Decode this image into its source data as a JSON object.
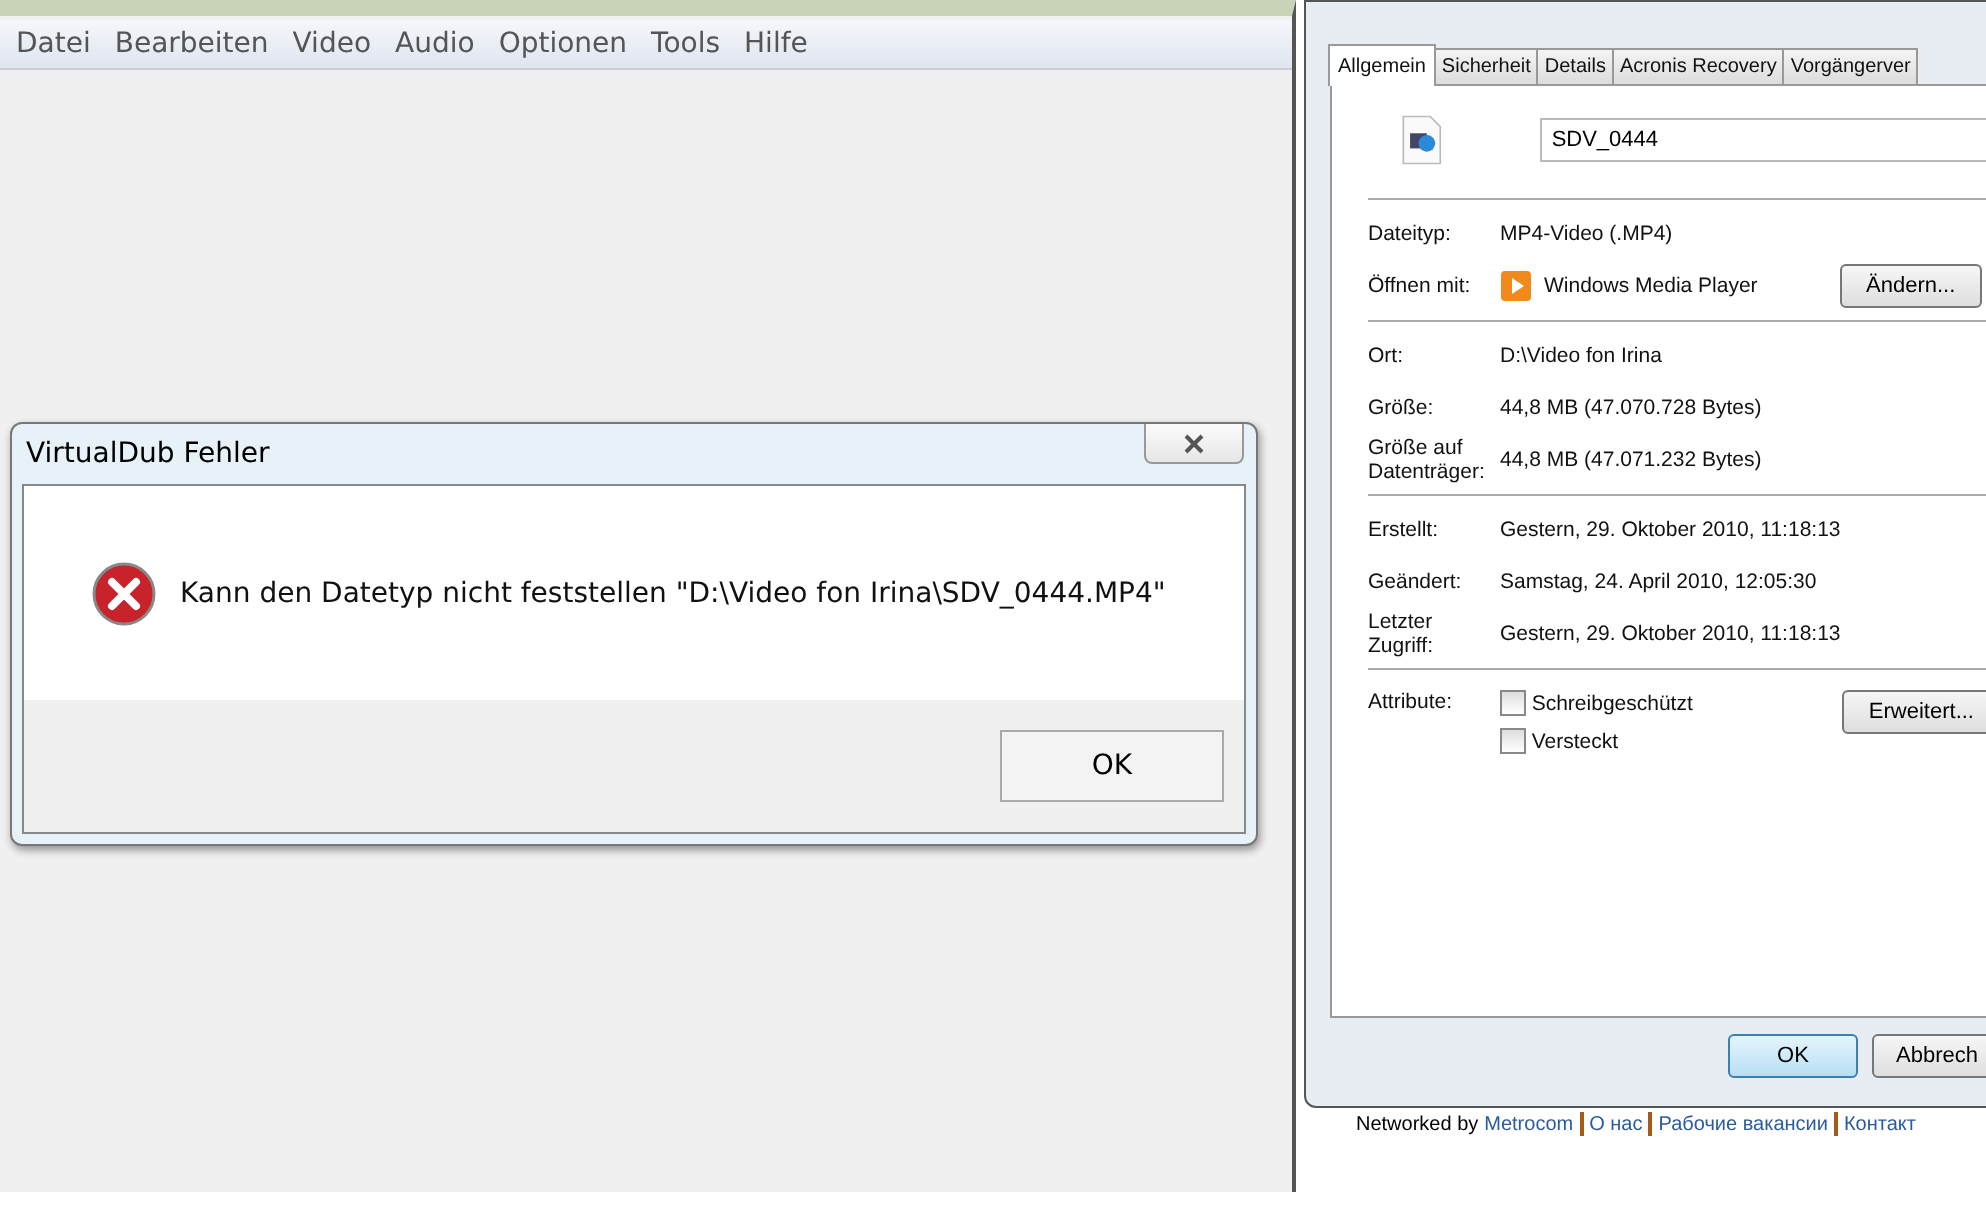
{
  "main_window": {
    "menu": [
      "Datei",
      "Bearbeiten",
      "Video",
      "Audio",
      "Optionen",
      "Tools",
      "Hilfe"
    ]
  },
  "error_dialog": {
    "title": "VirtualDub Fehler",
    "message": "Kann den Datetyp nicht feststellen \"D:\\Video fon Irina\\SDV_0444.MP4\"",
    "button": "OK"
  },
  "properties": {
    "tabs": [
      {
        "label": "Allgemein",
        "selected": true
      },
      {
        "label": "Sicherheit",
        "selected": false
      },
      {
        "label": "Details",
        "selected": false
      },
      {
        "label": "Acronis Recovery",
        "selected": false
      },
      {
        "label": "Vorgängerver",
        "selected": false
      }
    ],
    "file_name": "SDV_0444",
    "groups": [
      [
        {
          "kind": "text",
          "label": "Dateityp:",
          "value": "MP4-Video (.MP4)"
        },
        {
          "kind": "app",
          "label": "Öffnen mit:",
          "value": "Windows Media Player",
          "button": "Ändern..."
        }
      ],
      [
        {
          "kind": "text",
          "label": "Ort:",
          "value": "D:\\Video fon Irina"
        },
        {
          "kind": "text",
          "label": "Größe:",
          "value": "44,8 MB (47.070.728 Bytes)"
        },
        {
          "kind": "text",
          "label": "Größe auf Datenträger:",
          "value": "44,8 MB (47.071.232 Bytes)"
        }
      ],
      [
        {
          "kind": "text",
          "label": "Erstellt:",
          "value": "Gestern, 29. Oktober 2010, 11:18:13"
        },
        {
          "kind": "text",
          "label": "Geändert:",
          "value": "Samstag, 24. April 2010, 12:05:30"
        },
        {
          "kind": "text",
          "label": "Letzter Zugriff:",
          "value": "Gestern, 29. Oktober 2010, 11:18:13"
        }
      ]
    ],
    "attributes": {
      "label": "Attribute:",
      "items": [
        {
          "label": "Schreibgeschützt",
          "checked": false
        },
        {
          "label": "Versteckt",
          "checked": false
        }
      ],
      "button": "Erweitert..."
    },
    "buttons": [
      "OK",
      "Abbrech"
    ]
  },
  "footer": {
    "prefix": "Networked by",
    "links": [
      "Metrocom",
      "О нас",
      "Рабочие вакансии",
      "Контакт"
    ]
  }
}
